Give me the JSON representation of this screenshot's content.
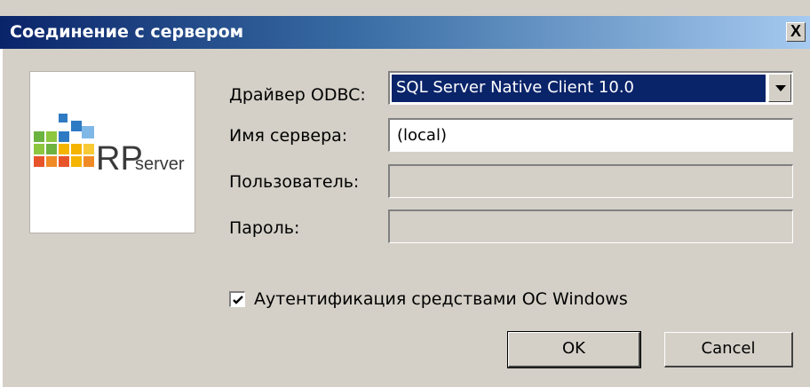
{
  "window": {
    "title": "Соединение с сервером",
    "close_glyph": "X"
  },
  "logo": {
    "text_rp": "RP",
    "text_server": "server",
    "colors": {
      "blue": "#2e7bc4",
      "green": "#6db33f",
      "yellow": "#f5b400",
      "orange": "#e8542a"
    }
  },
  "form": {
    "driver_label": "Драйвер ODBC:",
    "driver_value": "SQL Server Native Client 10.0",
    "server_label": "Имя сервера:",
    "server_value": "(local)",
    "user_label": "Пользователь:",
    "user_value": "",
    "password_label": "Пароль:",
    "password_value": "",
    "windows_auth_label": "Аутентификация средствами ОС Windows",
    "windows_auth_checked": true
  },
  "buttons": {
    "ok_label": "OK",
    "cancel_label": "Cancel"
  }
}
